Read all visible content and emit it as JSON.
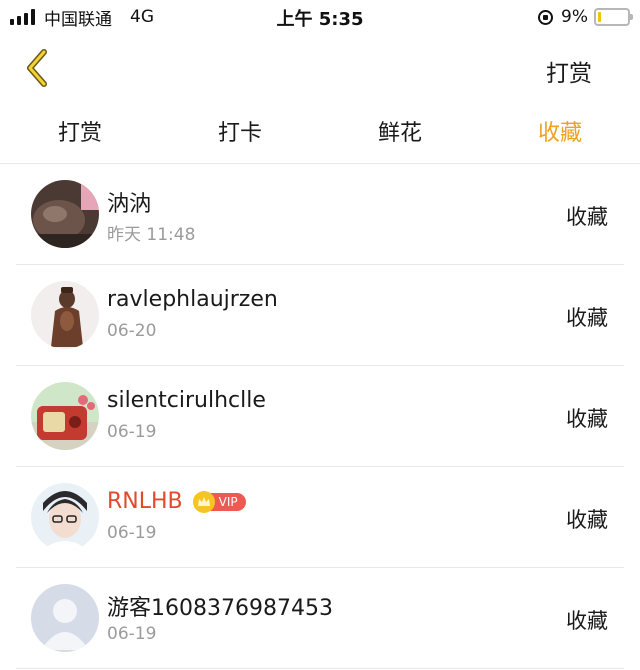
{
  "status_bar": {
    "carrier": "中国联通",
    "network": "4G",
    "time": "上午 5:35",
    "battery_percent": "9%",
    "battery_level": 0.09
  },
  "nav": {
    "back_icon": "chevron-left-icon",
    "action_label": "打赏"
  },
  "tabs": [
    {
      "label": "打赏",
      "active": false
    },
    {
      "label": "打卡",
      "active": false
    },
    {
      "label": "鲜花",
      "active": false
    },
    {
      "label": "收藏",
      "active": true
    }
  ],
  "colors": {
    "accent": "#f0a020",
    "vip_name": "#e24a2e",
    "vip_tag": "#ec5a52",
    "secondary_text": "#9b9b9b"
  },
  "items": [
    {
      "name": "汭汭",
      "date": "昨天 11:48",
      "action": "收藏",
      "vip": false
    },
    {
      "name": "ravlephlaujrzen",
      "date": "06-20",
      "action": "收藏",
      "vip": false
    },
    {
      "name": "silentcirulhclle",
      "date": "06-19",
      "action": "收藏",
      "vip": false
    },
    {
      "name": "RNLHB",
      "date": "06-19",
      "action": "收藏",
      "vip": true,
      "vip_label": "VIP"
    },
    {
      "name": "游客1608376987453",
      "date": "06-19",
      "action": "收藏",
      "vip": false
    }
  ]
}
